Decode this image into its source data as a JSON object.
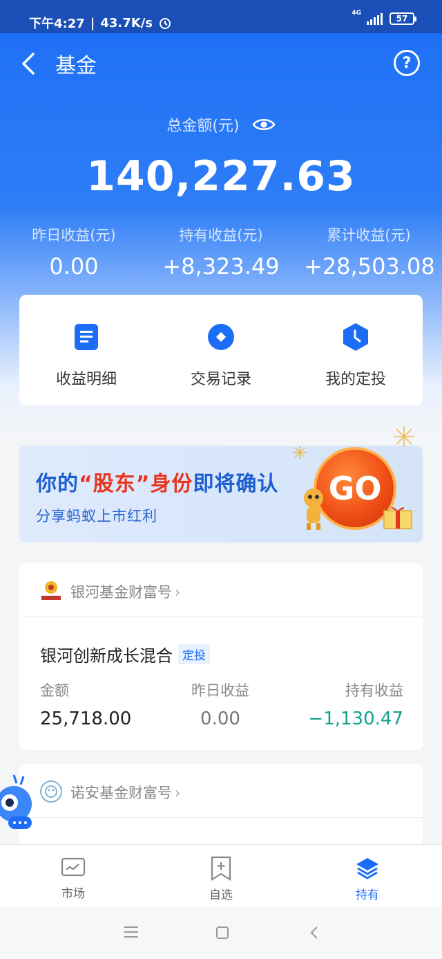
{
  "status_bar": {
    "time": "下午4:27",
    "net_speed": "43.7K/s",
    "network": "4G",
    "battery": "57"
  },
  "nav": {
    "title": "基金"
  },
  "summary": {
    "total_label": "总金额(元)",
    "total_value": "140,227.63",
    "stats": [
      {
        "label": "昨日收益(元)",
        "value": "0.00"
      },
      {
        "label": "持有收益(元)",
        "value": "+8,323.49"
      },
      {
        "label": "累计收益(元)",
        "value": "+28,503.08"
      }
    ]
  },
  "quick_actions": [
    {
      "label": "收益明细",
      "icon": "document-icon"
    },
    {
      "label": "交易记录",
      "icon": "record-circle-icon"
    },
    {
      "label": "我的定投",
      "icon": "clock-shield-icon"
    }
  ],
  "banner": {
    "title_part1": "你的",
    "title_quote": "“股东”",
    "title_part2": "身份",
    "title_part3": "即将确认",
    "subtitle": "分享蚂蚁上市红利",
    "go_label": "GO"
  },
  "funds": [
    {
      "org": "银河基金财富号",
      "name": "银河创新成长混合",
      "tag": "定投",
      "col_labels": [
        "金额",
        "昨日收益",
        "持有收益"
      ],
      "amount": "25,718.00",
      "yesterday": "0.00",
      "holding": "−1,130.47",
      "holding_color": "#14a08c"
    },
    {
      "org": "诺安基金财富号"
    }
  ],
  "tabbar": [
    {
      "label": "市场",
      "icon": "market-icon",
      "active": false
    },
    {
      "label": "自选",
      "icon": "bookmark-plus-icon",
      "active": false
    },
    {
      "label": "持有",
      "icon": "layers-icon",
      "active": true
    }
  ],
  "colors": {
    "primary": "#1b6df5",
    "negative": "#14a08c",
    "highlight": "#e8351f"
  }
}
